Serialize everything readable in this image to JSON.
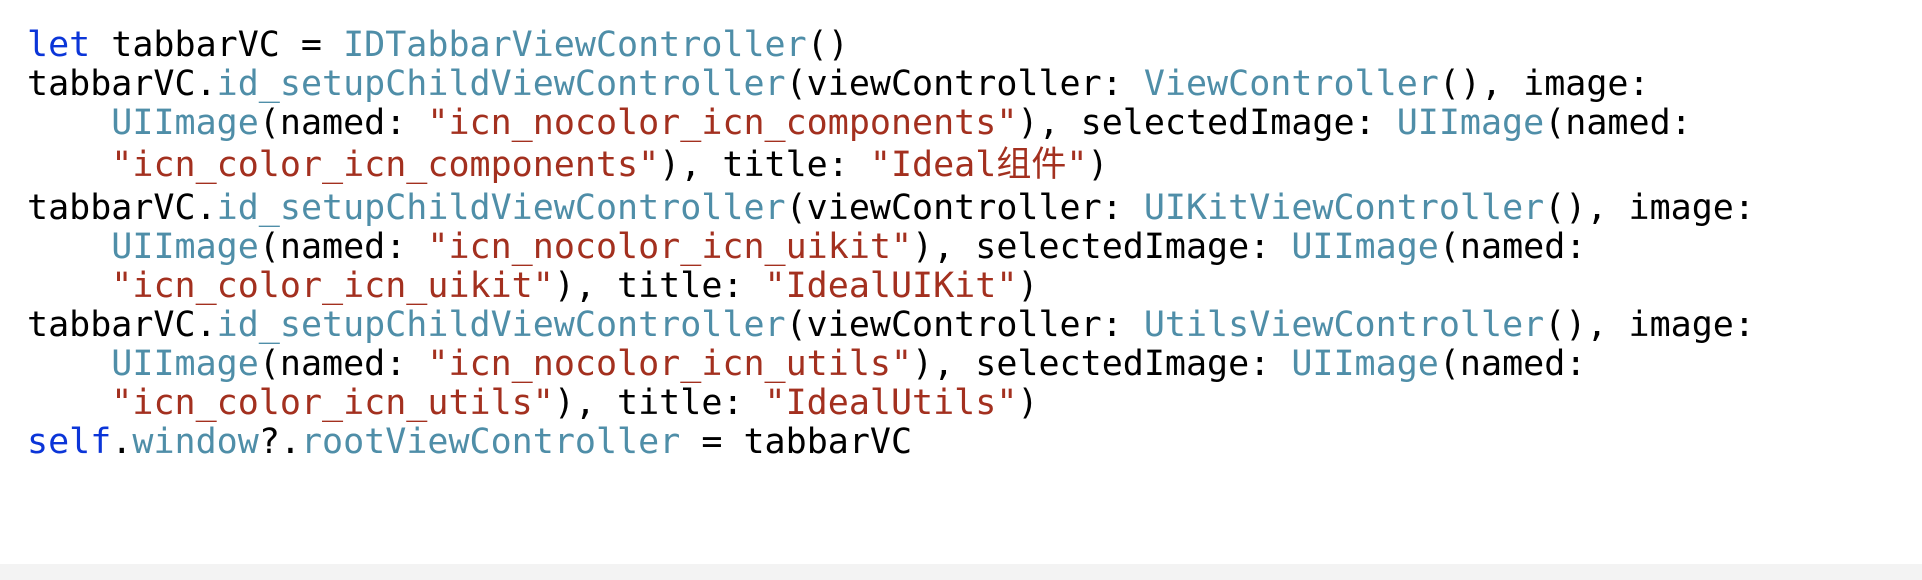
{
  "colors": {
    "keyword": "#0b35d8",
    "type": "#4f8ea8",
    "string": "#a3301f",
    "plain": "#000000",
    "background": "#ffffff"
  },
  "code": {
    "lines": [
      [
        [
          "kw",
          "let"
        ],
        [
          "pl",
          " tabbarVC = "
        ],
        [
          "ty",
          "IDTabbarViewController"
        ],
        [
          "pl",
          "()"
        ]
      ],
      [
        [
          "pl",
          "tabbarVC."
        ],
        [
          "ty",
          "id_setupChildViewController"
        ],
        [
          "pl",
          "(viewController: "
        ],
        [
          "ty",
          "ViewController"
        ],
        [
          "pl",
          "(), image:"
        ]
      ],
      [
        [
          "pl",
          "    "
        ],
        [
          "ty",
          "UIImage"
        ],
        [
          "pl",
          "(named: "
        ],
        [
          "str",
          "\"icn_nocolor_icn_components\""
        ],
        [
          "pl",
          "), selectedImage: "
        ],
        [
          "ty",
          "UIImage"
        ],
        [
          "pl",
          "(named:"
        ]
      ],
      [
        [
          "pl",
          "    "
        ],
        [
          "str",
          "\"icn_color_icn_components\""
        ],
        [
          "pl",
          "), title: "
        ],
        [
          "str",
          "\"Ideal组件\""
        ],
        [
          "pl",
          ")"
        ]
      ],
      [
        [
          "pl",
          "tabbarVC."
        ],
        [
          "ty",
          "id_setupChildViewController"
        ],
        [
          "pl",
          "(viewController: "
        ],
        [
          "ty",
          "UIKitViewController"
        ],
        [
          "pl",
          "(), image:"
        ]
      ],
      [
        [
          "pl",
          "    "
        ],
        [
          "ty",
          "UIImage"
        ],
        [
          "pl",
          "(named: "
        ],
        [
          "str",
          "\"icn_nocolor_icn_uikit\""
        ],
        [
          "pl",
          "), selectedImage: "
        ],
        [
          "ty",
          "UIImage"
        ],
        [
          "pl",
          "(named:"
        ]
      ],
      [
        [
          "pl",
          "    "
        ],
        [
          "str",
          "\"icn_color_icn_uikit\""
        ],
        [
          "pl",
          "), title: "
        ],
        [
          "str",
          "\"IdealUIKit\""
        ],
        [
          "pl",
          ")"
        ]
      ],
      [
        [
          "pl",
          "tabbarVC."
        ],
        [
          "ty",
          "id_setupChildViewController"
        ],
        [
          "pl",
          "(viewController: "
        ],
        [
          "ty",
          "UtilsViewController"
        ],
        [
          "pl",
          "(), image:"
        ]
      ],
      [
        [
          "pl",
          "    "
        ],
        [
          "ty",
          "UIImage"
        ],
        [
          "pl",
          "(named: "
        ],
        [
          "str",
          "\"icn_nocolor_icn_utils\""
        ],
        [
          "pl",
          "), selectedImage: "
        ],
        [
          "ty",
          "UIImage"
        ],
        [
          "pl",
          "(named:"
        ]
      ],
      [
        [
          "pl",
          "    "
        ],
        [
          "str",
          "\"icn_color_icn_utils\""
        ],
        [
          "pl",
          "), title: "
        ],
        [
          "str",
          "\"IdealUtils\""
        ],
        [
          "pl",
          ")"
        ]
      ],
      [
        [
          "kw",
          "self"
        ],
        [
          "pl",
          "."
        ],
        [
          "ty",
          "window"
        ],
        [
          "pl",
          "?."
        ],
        [
          "ty",
          "rootViewController"
        ],
        [
          "pl",
          " = tabbarVC"
        ]
      ]
    ]
  }
}
